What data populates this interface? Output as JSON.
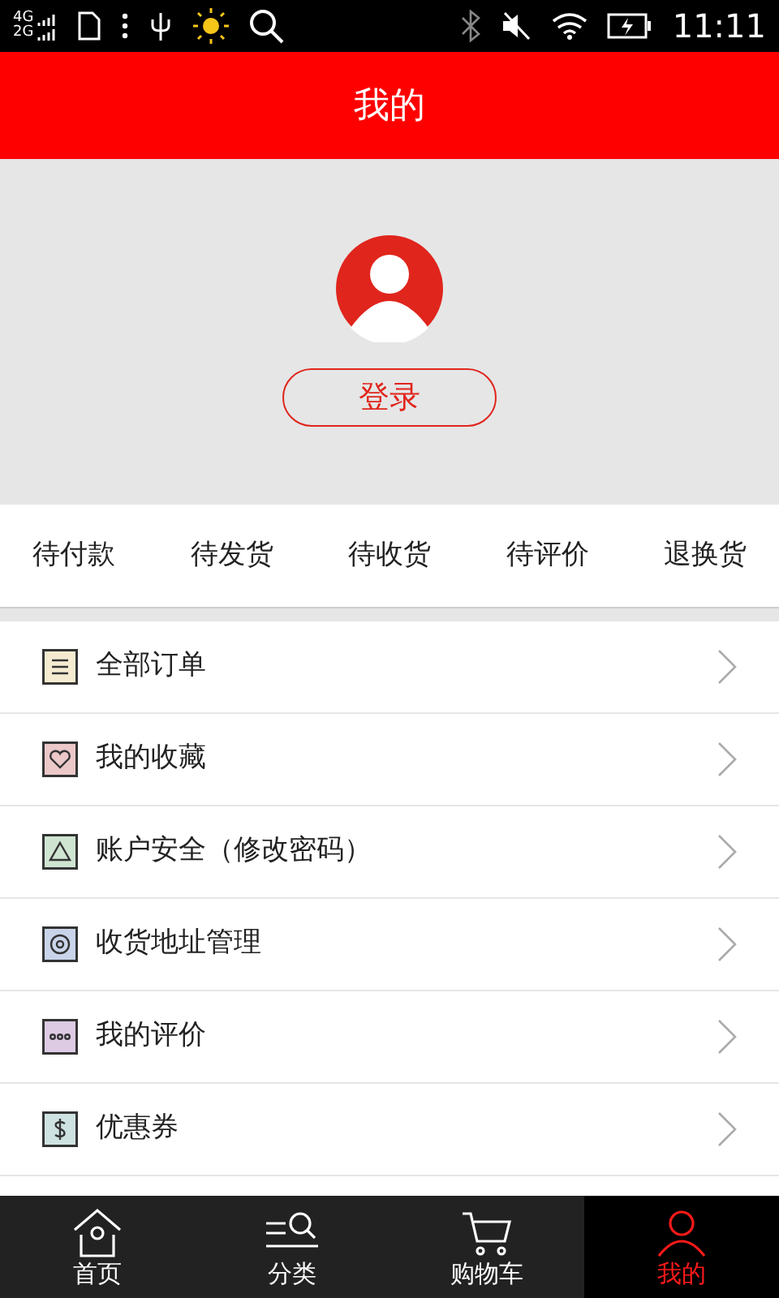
{
  "status_bar": {
    "networks": [
      "4G",
      "2G"
    ],
    "time": "11:11"
  },
  "header": {
    "title": "我的"
  },
  "profile": {
    "login_button": "登录"
  },
  "order_status": [
    "待付款",
    "待发货",
    "待收货",
    "待评价",
    "退换货"
  ],
  "menu": [
    {
      "label": "全部订单",
      "kind": "list",
      "color": "#f5ebd0"
    },
    {
      "label": "我的收藏",
      "kind": "heart",
      "color": "#ecc8c8"
    },
    {
      "label": "账户安全（修改密码）",
      "kind": "triangle",
      "color": "#cfe5d2"
    },
    {
      "label": "收货地址管理",
      "kind": "target",
      "color": "#c9d4ea"
    },
    {
      "label": "我的评价",
      "kind": "dots",
      "color": "#dccbe3"
    },
    {
      "label": "优惠券",
      "kind": "dollar",
      "color": "#cfe2e2"
    }
  ],
  "tab_bar": [
    {
      "label": "首页",
      "kind": "home",
      "selected": false
    },
    {
      "label": "分类",
      "kind": "category",
      "selected": false
    },
    {
      "label": "购物车",
      "kind": "cart",
      "selected": false
    },
    {
      "label": "我的",
      "kind": "user",
      "selected": true
    }
  ]
}
